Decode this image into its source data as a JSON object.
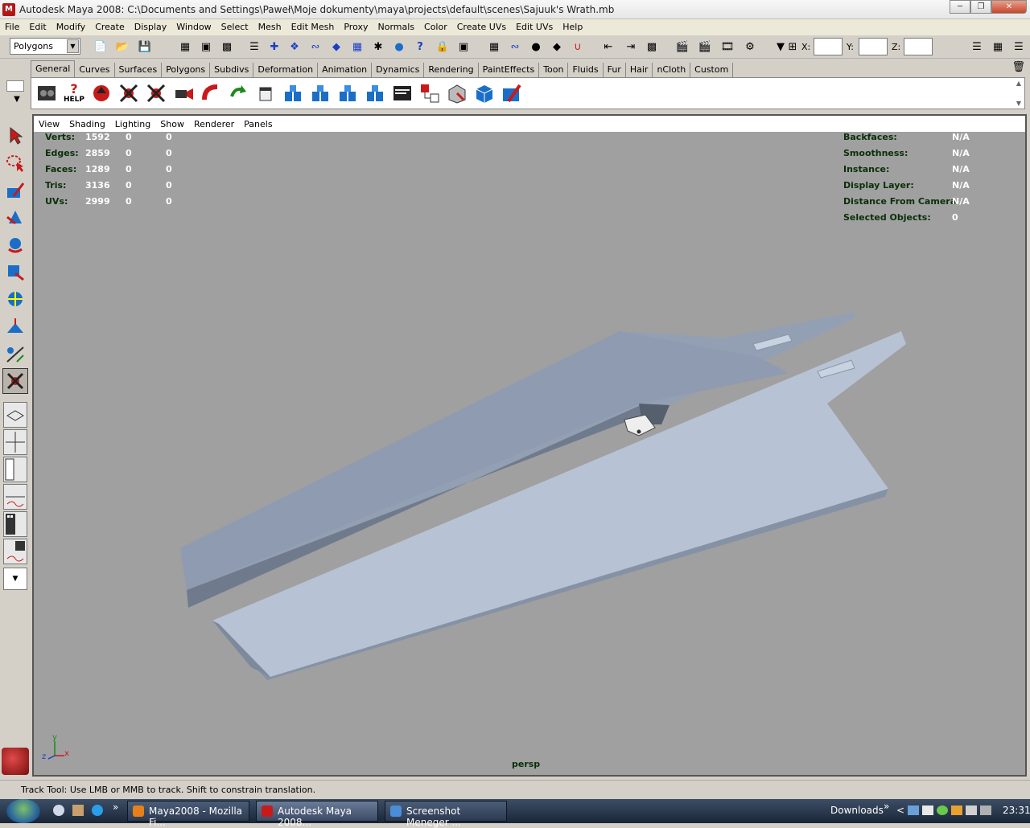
{
  "window": {
    "title": "Autodesk Maya 2008: C:\\Documents and Settings\\Paweł\\Moje dokumenty\\maya\\projects\\default\\scenes\\Sajuuk's Wrath.mb",
    "app_icon": "maya-icon"
  },
  "menubar": [
    "File",
    "Edit",
    "Modify",
    "Create",
    "Display",
    "Window",
    "Select",
    "Mesh",
    "Edit Mesh",
    "Proxy",
    "Normals",
    "Color",
    "Create UVs",
    "Edit UVs",
    "Help"
  ],
  "statusline": {
    "mode": "Polygons",
    "x_label": "X:",
    "y_label": "Y:",
    "z_label": "Z:"
  },
  "shelf": {
    "tabs": [
      "General",
      "Curves",
      "Surfaces",
      "Polygons",
      "Subdivs",
      "Deformation",
      "Animation",
      "Dynamics",
      "Rendering",
      "PaintEffects",
      "Toon",
      "Fluids",
      "Fur",
      "Hair",
      "nCloth",
      "Custom"
    ],
    "active_tab": "General",
    "help_label": "HELP"
  },
  "viewport": {
    "menu": [
      "View",
      "Shading",
      "Lighting",
      "Show",
      "Renderer",
      "Panels"
    ],
    "camera": "persp",
    "hud_left": [
      {
        "label": "Verts:",
        "v1": "1592",
        "v2": "0",
        "v3": "0"
      },
      {
        "label": "Edges:",
        "v1": "2859",
        "v2": "0",
        "v3": "0"
      },
      {
        "label": "Faces:",
        "v1": "1289",
        "v2": "0",
        "v3": "0"
      },
      {
        "label": "Tris:",
        "v1": "3136",
        "v2": "0",
        "v3": "0"
      },
      {
        "label": "UVs:",
        "v1": "2999",
        "v2": "0",
        "v3": "0"
      }
    ],
    "hud_right": [
      {
        "label": "Backfaces:",
        "value": "N/A"
      },
      {
        "label": "Smoothness:",
        "value": "N/A"
      },
      {
        "label": "Instance:",
        "value": "N/A"
      },
      {
        "label": "Display Layer:",
        "value": "N/A"
      },
      {
        "label": "Distance From Camera:",
        "value": "N/A"
      },
      {
        "label": "Selected Objects:",
        "value": "0"
      }
    ],
    "axis": {
      "y": "y",
      "z": "z",
      "x": "x"
    }
  },
  "statusbar": {
    "message": "Track Tool: Use LMB or MMB to track. Shift to constrain translation."
  },
  "taskbar": {
    "apps": [
      {
        "label": "Maya2008 - Mozilla Fi...",
        "active": false
      },
      {
        "label": "Autodesk Maya 2008...",
        "active": true
      },
      {
        "label": "Screenshot Meneger ...",
        "active": false
      }
    ],
    "downloads_label": "Downloads",
    "clock": "23:31"
  },
  "colors": {
    "viewport_bg": "#a0a0a0",
    "model_light": "#b7c3d4",
    "model_mid": "#93a0b4",
    "model_dark": "#6f7b8d",
    "hud_text": "#0a2f0a"
  }
}
